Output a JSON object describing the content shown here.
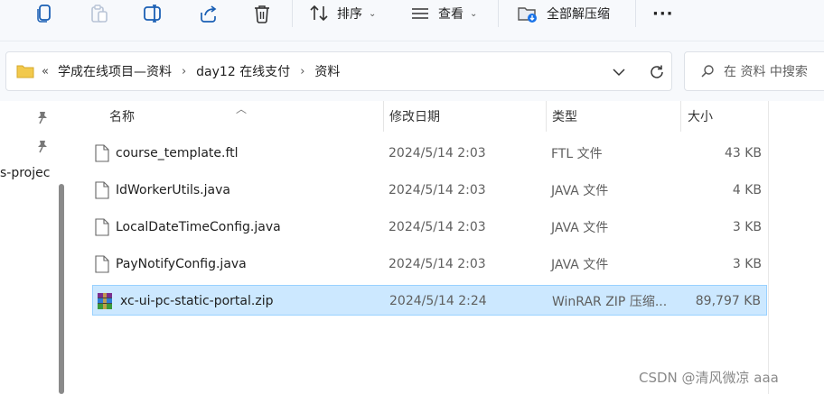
{
  "toolbar": {
    "sort_label": "排序",
    "view_label": "查看",
    "extract_all_label": "全部解压缩",
    "more_label": "···"
  },
  "address": {
    "more": "«",
    "crumbs": [
      "学成在线项目—资料",
      "day12 在线支付",
      "资料"
    ],
    "separator": "›"
  },
  "search": {
    "placeholder": "在 资料 中搜索"
  },
  "nav": {
    "visible_text": "s-projec"
  },
  "columns": {
    "name": "名称",
    "modified": "修改日期",
    "type": "类型",
    "size": "大小"
  },
  "files": [
    {
      "name": "course_template.ftl",
      "modified": "2024/5/14 2:03",
      "type": "FTL 文件",
      "size": "43 KB",
      "icon": "file-icon"
    },
    {
      "name": "IdWorkerUtils.java",
      "modified": "2024/5/14 2:03",
      "type": "JAVA 文件",
      "size": "4 KB",
      "icon": "file-icon"
    },
    {
      "name": "LocalDateTimeConfig.java",
      "modified": "2024/5/14 2:03",
      "type": "JAVA 文件",
      "size": "3 KB",
      "icon": "file-icon"
    },
    {
      "name": "PayNotifyConfig.java",
      "modified": "2024/5/14 2:03",
      "type": "JAVA 文件",
      "size": "3 KB",
      "icon": "file-icon"
    },
    {
      "name": "xc-ui-pc-static-portal.zip",
      "modified": "2024/5/14 2:24",
      "type": "WinRAR ZIP 压缩...",
      "size": "89,797 KB",
      "icon": "winrar-icon",
      "selected": true
    }
  ],
  "watermark": "CSDN @清风微凉 aaa",
  "colors": {
    "selected_bg": "#cce8ff",
    "selected_border": "#99d1ff",
    "toolbar_bg": "#f7f9fc"
  }
}
